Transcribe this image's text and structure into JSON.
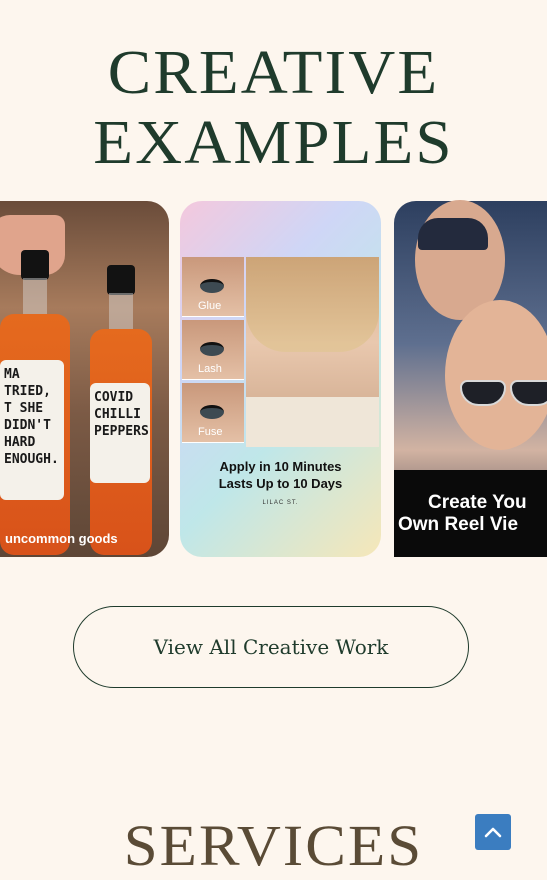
{
  "section_creative": {
    "title_line1": "CREATIVE",
    "title_line2": "EXAMPLES"
  },
  "cards": [
    {
      "bottle1_label": "MA TRIED, T SHE DIDN'T HARD ENOUGH.",
      "bottle2_label": "COVID CHILLI PEPPERS",
      "brand": "uncommon goods"
    },
    {
      "eye_labels": [
        "Glue",
        "Lash",
        "Fuse"
      ],
      "promo_line1": "Apply in 10 Minutes",
      "promo_line2": "Lasts Up to 10 Days",
      "brand": "LILAC ST."
    },
    {
      "caption_line1": "Create You",
      "caption_line2": "Own Reel Vie"
    }
  ],
  "cta": {
    "label": "View All Creative Work"
  },
  "section_services": {
    "title": "SERVICES"
  },
  "back_to_top": {
    "icon": "chevron-up-icon",
    "color": "#3b7dc0"
  },
  "colors": {
    "background": "#fdf6ee",
    "heading": "#1f3b2c",
    "services_heading": "#5a4b36"
  }
}
